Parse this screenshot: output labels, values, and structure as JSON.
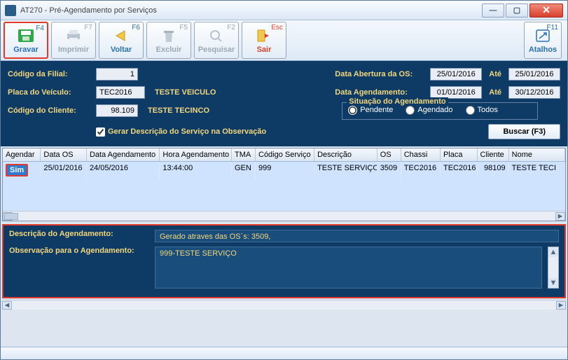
{
  "window": {
    "title": "AT270 - Pré-Agendamento por Serviços"
  },
  "toolbar": {
    "gravar": {
      "label": "Gravar",
      "fkey": "F4"
    },
    "imprimir": {
      "label": "Imprimir",
      "fkey": "F7"
    },
    "voltar": {
      "label": "Voltar",
      "fkey": "F6"
    },
    "excluir": {
      "label": "Excluir",
      "fkey": "F5"
    },
    "pesquisar": {
      "label": "Pesquisar",
      "fkey": "F2"
    },
    "sair": {
      "label": "Sair",
      "fkey": "Esc"
    },
    "atalhos": {
      "label": "Atalhos",
      "fkey": "F11"
    }
  },
  "form": {
    "codigo_filial_label": "Código da Filial:",
    "codigo_filial_value": "1",
    "placa_label": "Placa do Veículo:",
    "placa_value": "TEC2016",
    "placa_desc": "TESTE VEICULO",
    "cliente_label": "Código do Cliente:",
    "cliente_value": "98.109",
    "cliente_desc": "TESTE TECINCO",
    "check_label": "Gerar Descrição do Serviço na Observação",
    "data_abertura_label": "Data Abertura da OS:",
    "data_abertura_de": "25/01/2016",
    "data_abertura_ate": "25/01/2016",
    "data_agend_label": "Data Agendamento:",
    "data_agend_de": "01/01/2016",
    "data_agend_ate": "30/12/2016",
    "ate": "Até",
    "situacao_legend": "Situação do Agendamento",
    "situacao_pendente": "Pendente",
    "situacao_agendado": "Agendado",
    "situacao_todos": "Todos",
    "buscar_label": "Buscar (F3)"
  },
  "grid": {
    "headers": [
      "Agendar",
      "Data OS",
      "Data Agendamento",
      "Hora Agendamento",
      "TMA",
      "Código Serviço",
      "Descrição",
      "OS",
      "Chassi",
      "Placa",
      "Cliente",
      "Nome"
    ],
    "row": {
      "agendar": "Sim",
      "data_os": "25/01/2016",
      "data_agend": "24/05/2016",
      "hora": "13:44:00",
      "tma": "GEN",
      "cod_serv": "999",
      "desc": "TESTE SERVIÇO",
      "os": "3509",
      "chassi": "TEC2016",
      "placa": "TEC2016",
      "cliente": "98109",
      "nome": "TESTE TECI"
    }
  },
  "bottom": {
    "desc_label": "Descrição do Agendamento:",
    "desc_value": "Gerado atraves das OS´s: 3509,",
    "obs_label": "Observação para o Agendamento:",
    "obs_value": "999-TESTE SERVIÇO"
  }
}
